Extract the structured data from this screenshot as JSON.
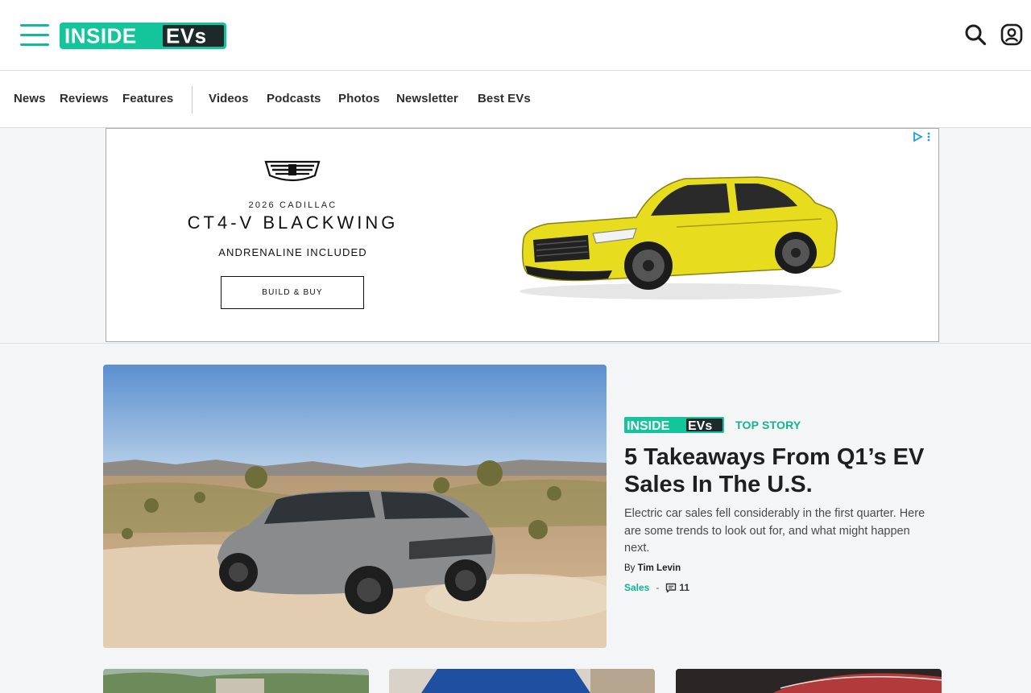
{
  "header": {
    "logo_text": {
      "part1": "INSIDE",
      "part2": "EVs"
    },
    "menu_icon": "hamburger-icon",
    "search_icon": "search-icon",
    "account_icon": "user-icon",
    "brand_color": "#14b89a"
  },
  "nav": {
    "items": [
      "News",
      "Reviews",
      "Features",
      "Videos",
      "Podcasts",
      "Photos",
      "Newsletter",
      "Best EVs"
    ]
  },
  "ad": {
    "year_make": "2026 CADILLAC",
    "model": "CT4-V BLACKWING",
    "tagline": "ANDRENALINE INCLUDED",
    "cta": "BUILD & BUY",
    "car_color": "#e8dc1e"
  },
  "top_story": {
    "brand": {
      "part1": "INSIDE",
      "part2": "EVs"
    },
    "label": "TOP STORY",
    "title": "5 Takeaways From Q1’s EV Sales In The U.S.",
    "description": "Electric car sales fell considerably in the first quarter. Here are some trends to look out for, and what might happen next.",
    "byline_prefix": "By",
    "author": "Tim Levin",
    "category": "Sales",
    "separator": "-",
    "comments": "11",
    "accent_color": "#12b58f"
  }
}
